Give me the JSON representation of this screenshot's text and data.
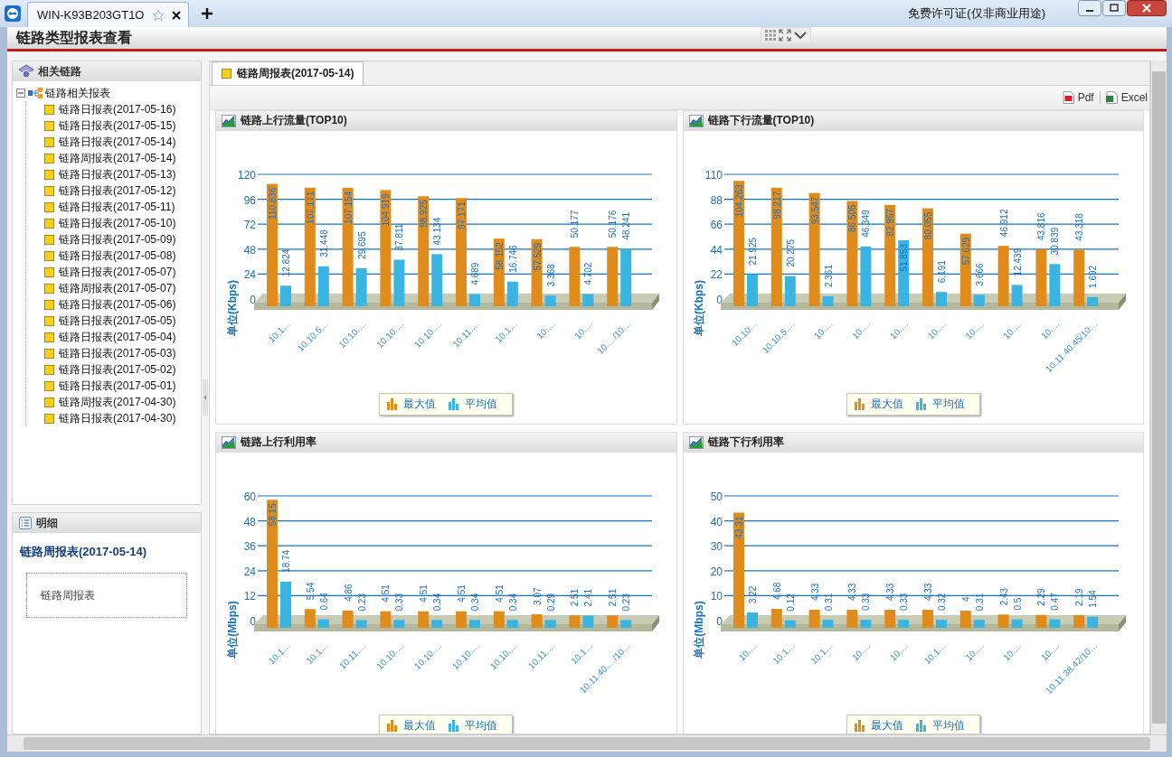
{
  "window": {
    "tab_title": "WIN-K93B203GT1O",
    "license": "免费许可证(仅非商业用途)"
  },
  "app": {
    "title": "链路类型报表查看"
  },
  "sidebar": {
    "tree_panel": {
      "title": "相关链路",
      "tree": [
        {
          "label": "链路相关报表",
          "expanded": true,
          "children": [
            {
              "label": "链路日报表(2017-05-16)"
            },
            {
              "label": "链路日报表(2017-05-15)"
            },
            {
              "label": "链路日报表(2017-05-14)"
            },
            {
              "label": "链路周报表(2017-05-14)"
            },
            {
              "label": "链路日报表(2017-05-13)"
            },
            {
              "label": "链路日报表(2017-05-12)"
            },
            {
              "label": "链路日报表(2017-05-11)"
            },
            {
              "label": "链路日报表(2017-05-10)"
            },
            {
              "label": "链路日报表(2017-05-09)"
            },
            {
              "label": "链路日报表(2017-05-08)"
            },
            {
              "label": "链路日报表(2017-05-07)"
            },
            {
              "label": "链路周报表(2017-05-07)"
            },
            {
              "label": "链路日报表(2017-05-06)"
            },
            {
              "label": "链路日报表(2017-05-05)"
            },
            {
              "label": "链路日报表(2017-05-04)"
            },
            {
              "label": "链路日报表(2017-05-03)"
            },
            {
              "label": "链路日报表(2017-05-02)"
            },
            {
              "label": "链路日报表(2017-05-01)"
            },
            {
              "label": "链路周报表(2017-04-30)"
            },
            {
              "label": "链路日报表(2017-04-30)"
            }
          ]
        }
      ]
    },
    "detail_panel": {
      "title": "明细",
      "heading": "链路周报表(2017-05-14)",
      "text": "链路周报表"
    }
  },
  "tabs": [
    {
      "label": "链路周报表(2017-05-14)",
      "selected": true
    }
  ],
  "toolbar": {
    "buttons": [
      {
        "label": "Pdf",
        "kind": "pdf"
      },
      {
        "label": "Excel",
        "kind": "excel"
      }
    ]
  },
  "charts": [
    {
      "title": "链路上行流量(TOP10)",
      "chart_data": {
        "type": "bar",
        "ylabel": "单位(Kbps)",
        "categories": [
          "10.1…",
          "10.10.5…",
          "10.10.…",
          "10.10.…",
          "10.10.…",
          "10.11.…",
          "10.1…",
          "10.…",
          "10.…",
          "10.…/10…"
        ],
        "series": [
          {
            "name": "最大值",
            "color": "#e08c1c",
            "values": [
              110.836,
              107.171,
              107.154,
              104.919,
              98.925,
              97.171,
              58.152,
              57.529,
              50.177,
              50.176
            ]
          },
          {
            "name": "平均值",
            "color": "#3ab4e0",
            "values": [
              12.824,
              31.448,
              29.695,
              37.811,
              43.134,
              4.689,
              16.746,
              3.368,
              4.702,
              48.241
            ]
          }
        ],
        "ylim": [
          0,
          120
        ],
        "yticks": [
          0,
          24,
          48,
          72,
          96,
          120
        ],
        "data_labels": true,
        "grid": true,
        "legend": true
      }
    },
    {
      "title": "链路下行流量(TOP10)",
      "chart_data": {
        "type": "bar",
        "ylabel": "单位(Kbps)",
        "categories": [
          "10.10…",
          "10.10.5.…",
          "10.…",
          "10.…",
          "10.…",
          "10.…",
          "10.…",
          "10.…",
          "10.…",
          "10.11.40.45/10…"
        ],
        "series": [
          {
            "name": "最大值",
            "color": "#e08c1c",
            "values": [
              104.263,
              98.217,
              93.547,
              86.505,
              82.957,
              80.055,
              57.629,
              46.912,
              43.816,
              43.318
            ]
          },
          {
            "name": "平均值",
            "color": "#3ab4e0",
            "values": [
              21.925,
              20.275,
              2.361,
              46.349,
              51.853,
              6.191,
              3.666,
              12.439,
              30.839,
              1.692
            ]
          }
        ],
        "ylim": [
          0,
          110
        ],
        "yticks": [
          0,
          22,
          44,
          66,
          88,
          110
        ],
        "data_labels": true,
        "grid": true,
        "legend": true
      }
    },
    {
      "title": "链路上行利用率",
      "chart_data": {
        "type": "bar",
        "ylabel": "单位(Mbps)",
        "categories": [
          "10.1…",
          "10.1…",
          "10.11.…",
          "10.10.…",
          "10.10.…",
          "10.10.…",
          "10.10.…",
          "10.11.…",
          "10.1…",
          "10.11.40.…/10…"
        ],
        "series": [
          {
            "name": "最大值",
            "color": "#e08c1c",
            "values": [
              58.15,
              5.54,
              4.86,
              4.51,
              4.51,
              4.51,
              4.51,
              3.07,
              2.51,
              2.51
            ]
          },
          {
            "name": "平均值",
            "color": "#3ab4e0",
            "values": [
              18.74,
              0.64,
              0.23,
              0.33,
              0.34,
              0.34,
              0.34,
              0.29,
              2.41,
              0.23
            ]
          }
        ],
        "ylim": [
          0,
          60
        ],
        "yticks": [
          0,
          12,
          24,
          36,
          48,
          60
        ],
        "data_labels": true,
        "grid": true,
        "legend": true
      }
    },
    {
      "title": "链路下行利用率",
      "chart_data": {
        "type": "bar",
        "ylabel": "单位(Mbps)",
        "categories": [
          "10.…",
          "10.1…",
          "10.1…",
          "10.…",
          "10.…",
          "10.1…",
          "10.…",
          "10.…",
          "10.…",
          "10.11.38.42/10…"
        ],
        "series": [
          {
            "name": "最大值",
            "color": "#e08c1c",
            "values": [
              43.31,
              4.68,
              4.33,
              4.33,
              4.33,
              4.33,
              4,
              2.43,
              2.29,
              2.19
            ]
          },
          {
            "name": "平均值",
            "color": "#3ab4e0",
            "values": [
              3.22,
              0.12,
              0.31,
              0.33,
              0.33,
              0.32,
              0.31,
              0.5,
              0.47,
              1.54
            ]
          }
        ],
        "ylim": [
          0,
          50
        ],
        "yticks": [
          0,
          10,
          20,
          30,
          40,
          50
        ],
        "data_labels": true,
        "grid": true,
        "legend": true
      }
    }
  ]
}
